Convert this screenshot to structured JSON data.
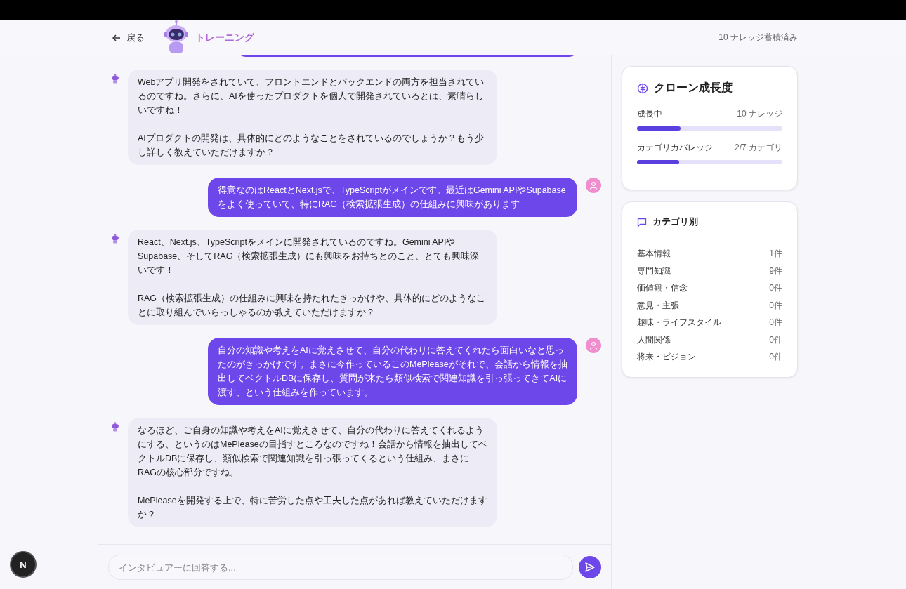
{
  "header": {
    "back_label": "戻る",
    "title": "トレーニング",
    "knowledge_count": "10 ナレッジ蓄積済み"
  },
  "messages": [
    {
      "kind": "user_cut"
    },
    {
      "kind": "ai",
      "text": "Webアプリ開発をされていて、フロントエンドとバックエンドの両方を担当されているのですね。さらに、AIを使ったプロダクトを個人で開発されているとは、素晴らしいですね！\n\nAIプロダクトの開発は、具体的にどのようなことをされているのでしょうか？もう少し詳しく教えていただけますか？"
    },
    {
      "kind": "user",
      "text": "得意なのはReactとNext.jsで、TypeScriptがメインです。最近はGemini APIやSupabaseをよく使っていて、特にRAG（検索拡張生成）の仕組みに興味があります"
    },
    {
      "kind": "ai",
      "text": "React、Next.js、TypeScriptをメインに開発されているのですね。Gemini APIやSupabase、そしてRAG（検索拡張生成）にも興味をお持ちとのこと、とても興味深いです！\n\nRAG（検索拡張生成）の仕組みに興味を持たれたきっかけや、具体的にどのようなことに取り組んでいらっしゃるのか教えていただけますか？"
    },
    {
      "kind": "user",
      "text": "自分の知識や考えをAIに覚えさせて、自分の代わりに答えてくれたら面白いなと思ったのがきっかけです。まさに今作っているこのMePleaseがそれで、会話から情報を抽出してベクトルDBに保存し、質問が来たら類似検索で関連知識を引っ張ってきてAIに渡す、という仕組みを作っています。"
    },
    {
      "kind": "ai",
      "text": "なるほど、ご自身の知識や考えをAIに覚えさせて、自分の代わりに答えてくれるようにする、というのはMePleaseの目指すところなのですね！会話から情報を抽出してベクトルDBに保存し、類似検索で関連知識を引っ張ってくるという仕組み、まさにRAGの核心部分ですね。\n\nMePleaseを開発する上で、特に苦労した点や工夫した点があれば教えていただけますか？"
    }
  ],
  "input": {
    "placeholder": "インタビュアーに回答する..."
  },
  "growth": {
    "title": "クローン成長度",
    "meters": [
      {
        "label": "成長中",
        "reading": "10 ナレッジ",
        "level": 0.3
      },
      {
        "label": "カテゴリカバレッジ",
        "reading": "2/7 カテゴリ",
        "level": 0.29
      }
    ]
  },
  "categories": {
    "title": "カテゴリ別",
    "items": [
      {
        "name": "基本情報",
        "count": "1件"
      },
      {
        "name": "専門知識",
        "count": "9件"
      },
      {
        "name": "価値観・信念",
        "count": "0件"
      },
      {
        "name": "意見・主張",
        "count": "0件"
      },
      {
        "name": "趣味・ライフスタイル",
        "count": "0件"
      },
      {
        "name": "人間関係",
        "count": "0件"
      },
      {
        "name": "将来・ビジョン",
        "count": "0件"
      }
    ]
  },
  "dev_badge": "N"
}
